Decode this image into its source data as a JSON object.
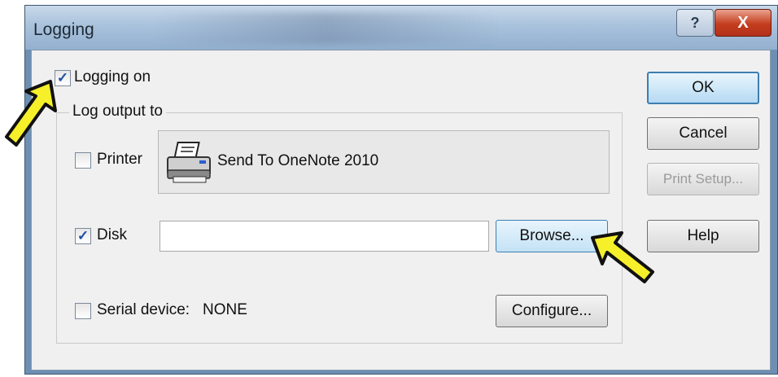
{
  "window": {
    "title": "Logging",
    "help_glyph": "?",
    "close_glyph": "X"
  },
  "logging_on": {
    "label": "Logging on",
    "checked": true
  },
  "group": {
    "legend": "Log output to"
  },
  "printer": {
    "label": "Printer",
    "checked": false,
    "device_name": "Send To OneNote 2010",
    "icon": "printer-icon"
  },
  "disk": {
    "label": "Disk",
    "checked": true,
    "path_value": ""
  },
  "serial": {
    "label": "Serial device:",
    "value": "NONE",
    "checked": false
  },
  "buttons": {
    "browse": "Browse...",
    "configure": "Configure...",
    "ok": "OK",
    "cancel": "Cancel",
    "print_setup": "Print Setup...",
    "help": "Help"
  },
  "annotations": {
    "arrow_color": "#f5f02a",
    "arrow_outline": "#111111"
  },
  "check_glyph": "✓"
}
